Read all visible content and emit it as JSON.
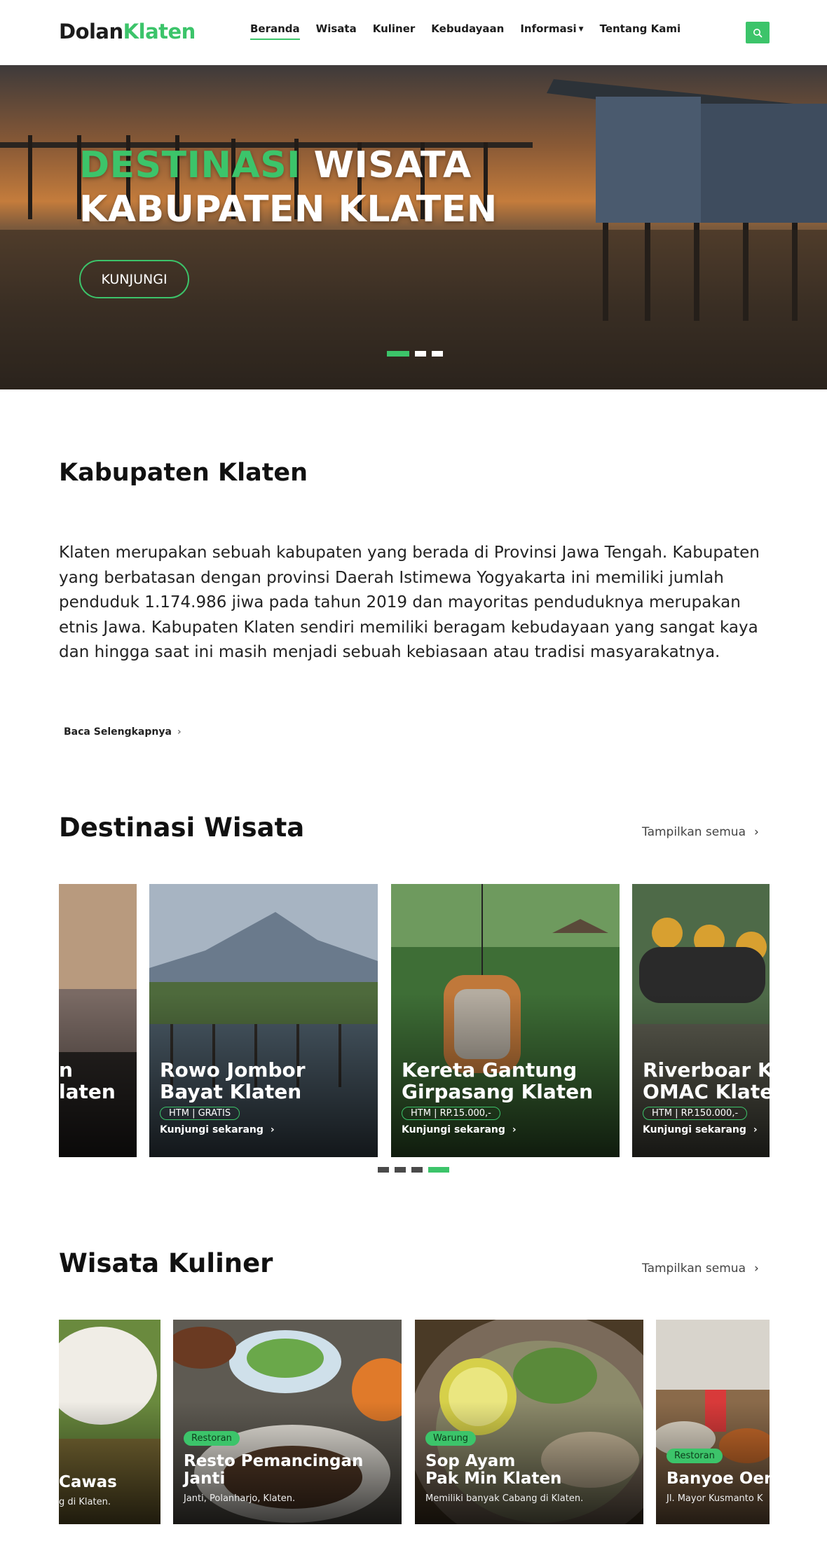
{
  "brand": {
    "part1": "Dolan",
    "part2": "Klaten"
  },
  "nav": {
    "items": [
      "Beranda",
      "Wisata",
      "Kuliner",
      "Kebudayaan",
      "Informasi",
      "Tentang Kami"
    ],
    "active": "Beranda"
  },
  "hero": {
    "title_green": "DESTINASI",
    "title_white1": "WISATA",
    "title_white2": "KABUPATEN KLATEN",
    "button": "KUNJUNGI",
    "slides": 3,
    "active_slide": 1
  },
  "about": {
    "title": "Kabupaten Klaten",
    "text": "Klaten merupakan sebuah kabupaten yang berada di Provinsi Jawa Tengah. Kabupaten yang berbatasan dengan provinsi Daerah Istimewa Yogyakarta ini memiliki jumlah penduduk 1.174.986 jiwa pada tahun 2019 dan mayoritas penduduknya merupakan etnis Jawa. Kabupaten Klaten sendiri memiliki beragam kebudayaan yang sangat kaya dan hingga saat ini masih menjadi sebuah kebiasaan atau tradisi masyarakatnya.",
    "read_more": "Baca Selengkapnya"
  },
  "destinations": {
    "title": "Destinasi Wisata",
    "show_all": "Tampilkan semua",
    "cards": [
      {
        "title_line1": "n",
        "title_line2": "laten"
      },
      {
        "title_line1": "Rowo Jombor",
        "title_line2": "Bayat Klaten",
        "htm": "HTM | GRATIS",
        "visit": "Kunjungi sekarang"
      },
      {
        "title_line1": "Kereta Gantung",
        "title_line2": "Girpasang Klaten",
        "htm": "HTM | RP.15.000,-",
        "visit": "Kunjungi sekarang"
      },
      {
        "title_line1": "Riverboar Ka",
        "title_line2": "OMAC Klater",
        "htm": "HTM | RP.150.000,-",
        "visit": "Kunjungi sekarang"
      }
    ],
    "pages": 4,
    "active_page": 4
  },
  "culinary": {
    "title": "Wisata Kuliner",
    "show_all": "Tampilkan semua",
    "cards": [
      {
        "title_line1": "Cawas",
        "desc": "g di Klaten."
      },
      {
        "badge": "Restoran",
        "title_line1": "Resto Pemancingan",
        "title_line2": "Janti",
        "desc": "Janti, Polanharjo, Klaten."
      },
      {
        "badge": "Warung",
        "title_line1": "Sop Ayam",
        "title_line2": "Pak Min Klaten",
        "desc": "Memiliki banyak Cabang di Klaten."
      },
      {
        "badge": "Restoran",
        "title_line1": "Banyoe Oerie",
        "desc": "Jl. Mayor Kusmanto K"
      }
    ]
  },
  "colors": {
    "accent": "#3cc46a",
    "text": "#111111"
  },
  "icons": {
    "search": "search-icon",
    "chevron": "chevron-right-icon",
    "caret": "caret-down-icon"
  }
}
